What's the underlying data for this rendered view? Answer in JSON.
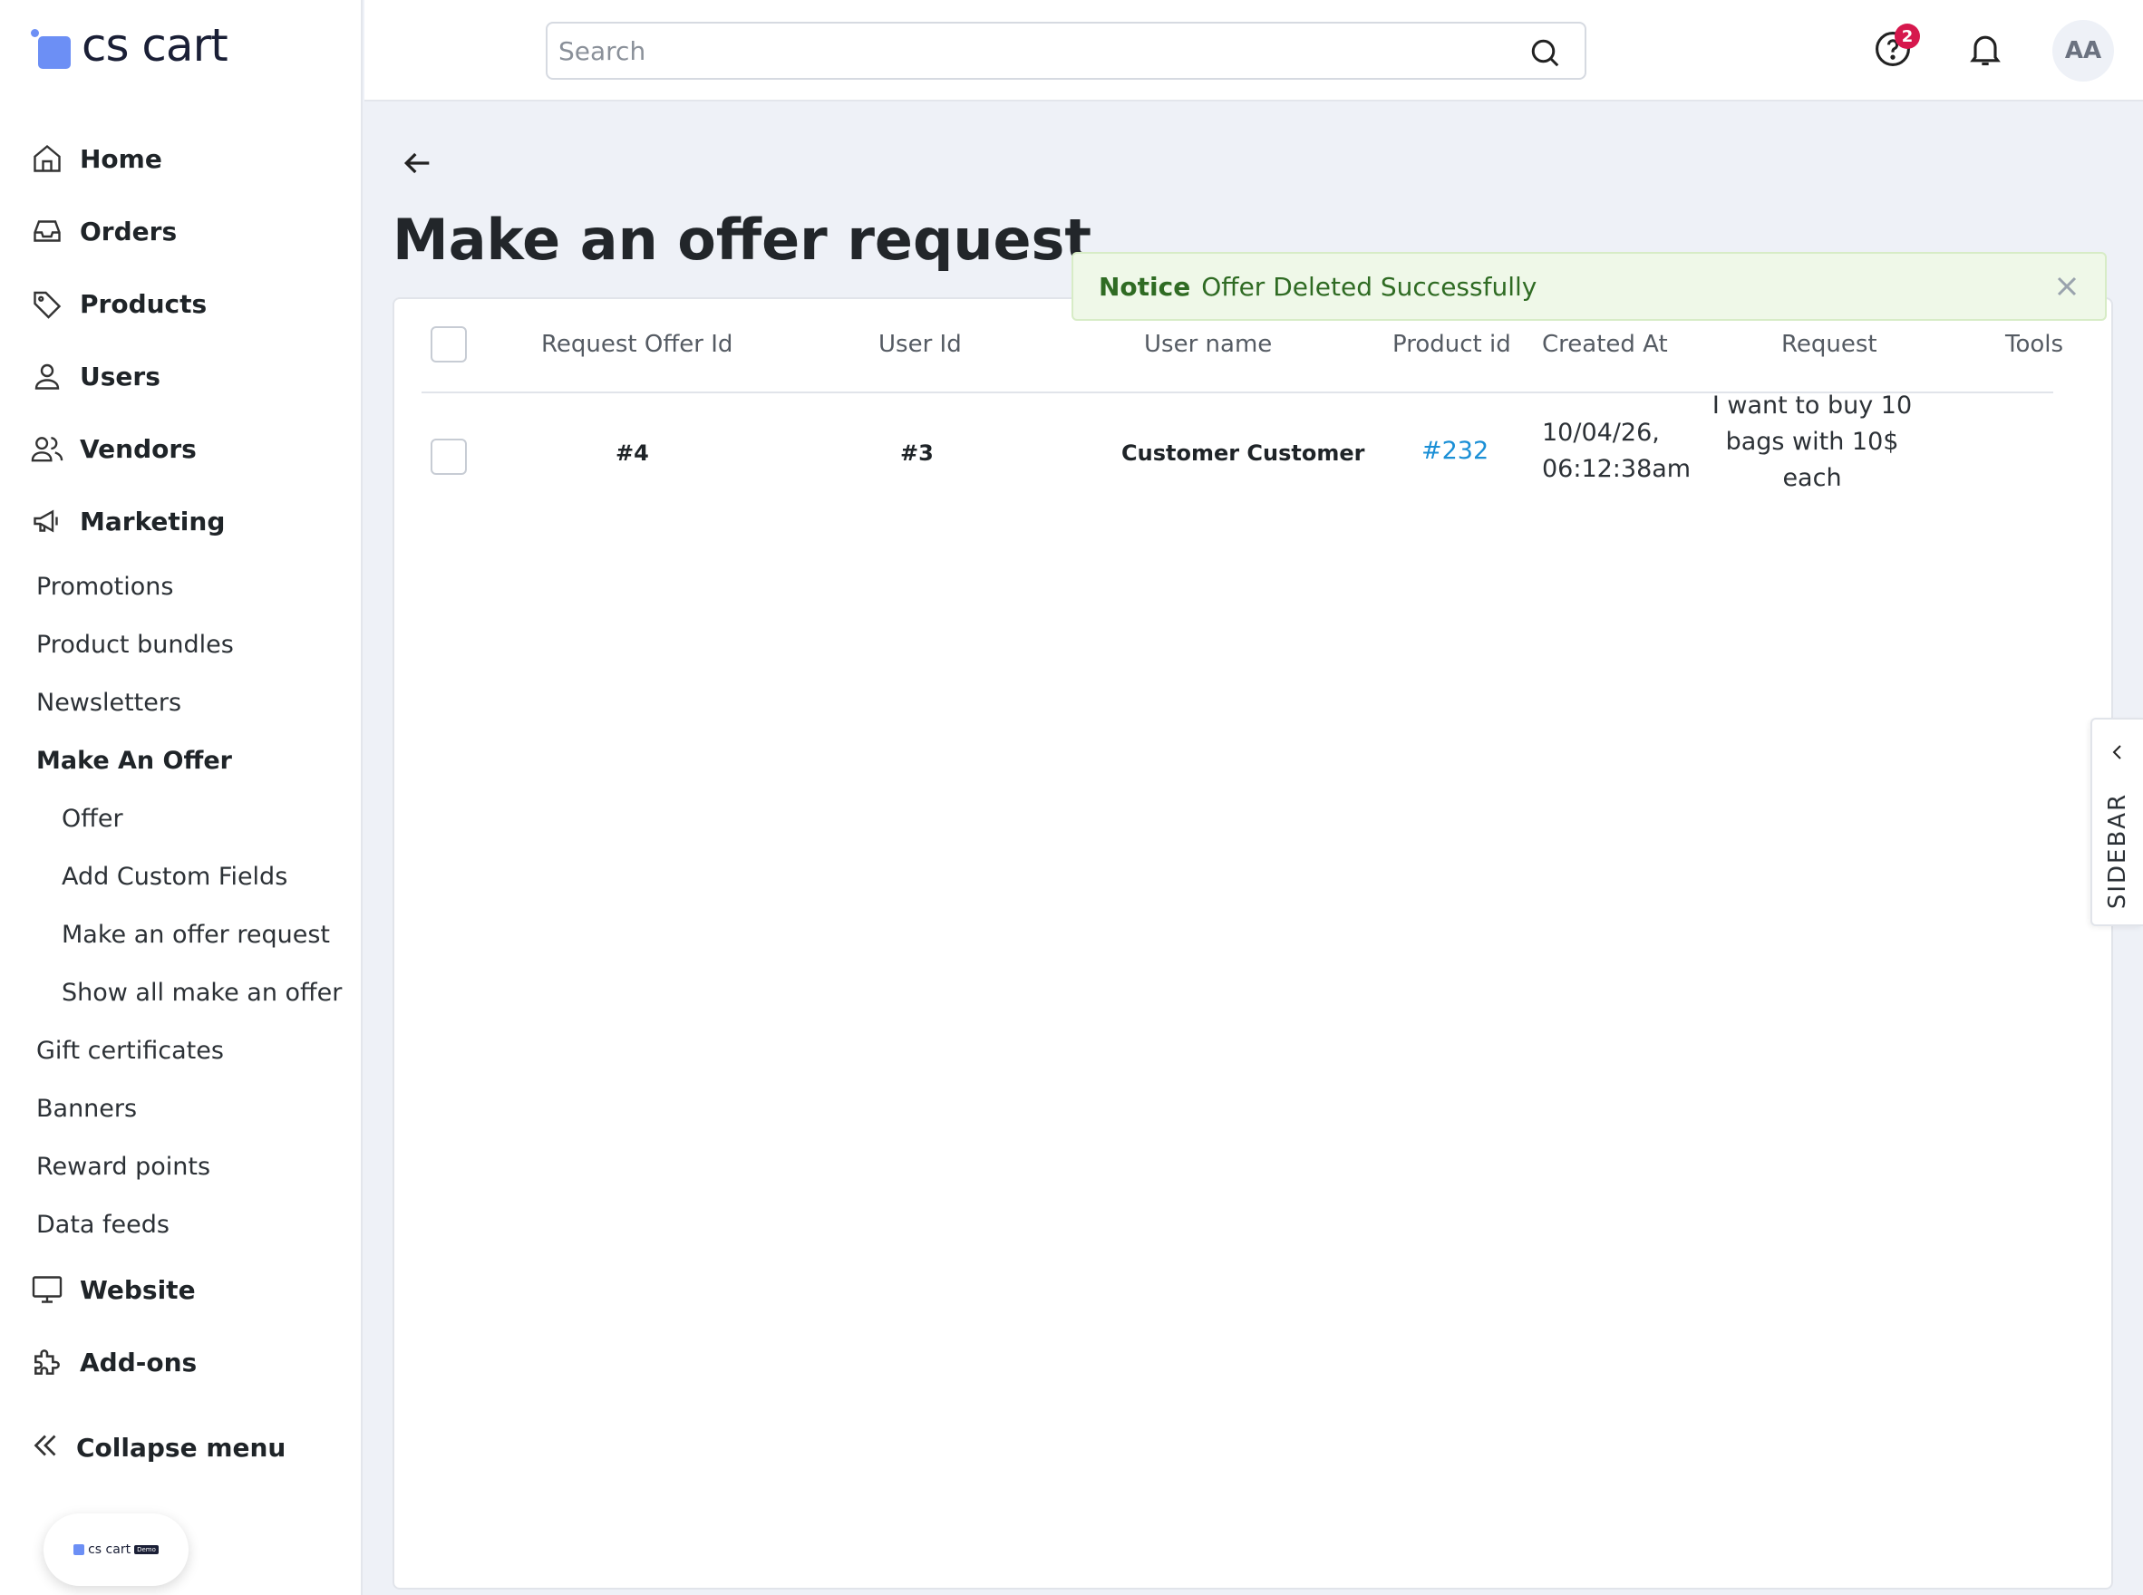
{
  "brand": {
    "logo_text": "cs cart",
    "demo_badge_text": "cs cart",
    "demo_badge_tag": "Demo"
  },
  "header": {
    "search_placeholder": "Search",
    "help_badge_count": "2",
    "avatar_initials": "AA"
  },
  "sidebar": {
    "main_items": [
      {
        "label": "Home",
        "icon": "home-icon"
      },
      {
        "label": "Orders",
        "icon": "inbox-icon"
      },
      {
        "label": "Products",
        "icon": "tag-icon"
      },
      {
        "label": "Users",
        "icon": "user-icon"
      },
      {
        "label": "Vendors",
        "icon": "users-icon"
      },
      {
        "label": "Marketing",
        "icon": "megaphone-icon"
      }
    ],
    "marketing_items": [
      {
        "label": "Promotions"
      },
      {
        "label": "Product bundles"
      },
      {
        "label": "Newsletters"
      },
      {
        "label": "Make An Offer",
        "active": true
      }
    ],
    "make_offer_items": [
      {
        "label": "Offer"
      },
      {
        "label": "Add Custom Fields"
      },
      {
        "label": "Make an offer request"
      },
      {
        "label": "Show all make an offer …"
      }
    ],
    "marketing_items_after": [
      {
        "label": "Gift certificates"
      },
      {
        "label": "Banners"
      },
      {
        "label": "Reward points"
      },
      {
        "label": "Data feeds"
      }
    ],
    "bottom_items": [
      {
        "label": "Website",
        "icon": "monitor-icon"
      },
      {
        "label": "Add-ons",
        "icon": "puzzle-icon"
      }
    ],
    "collapse_label": "Collapse menu"
  },
  "page": {
    "title": "Make an offer request",
    "notice_title": "Notice",
    "notice_message": "Offer Deleted Successfully",
    "sidebar_tab_label": "SIDEBAR"
  },
  "table": {
    "columns": [
      "Request Offer Id",
      "User Id",
      "User name",
      "Product id",
      "Created At",
      "Request",
      "Tools"
    ],
    "rows": [
      {
        "request_offer_id": "#4",
        "user_id": "#3",
        "user_name": "Customer Customer",
        "product_id": "#232",
        "created_at_line1": "10/04/26,",
        "created_at_line2": "06:12:38am",
        "request": "I want to buy 10 bags with 10$ each"
      }
    ]
  },
  "colors": {
    "accent": "#6c8ff5",
    "link": "#1a8fd6",
    "notice_bg": "#eff8e8",
    "notice_text": "#2f6b23",
    "badge": "#d6184d"
  }
}
